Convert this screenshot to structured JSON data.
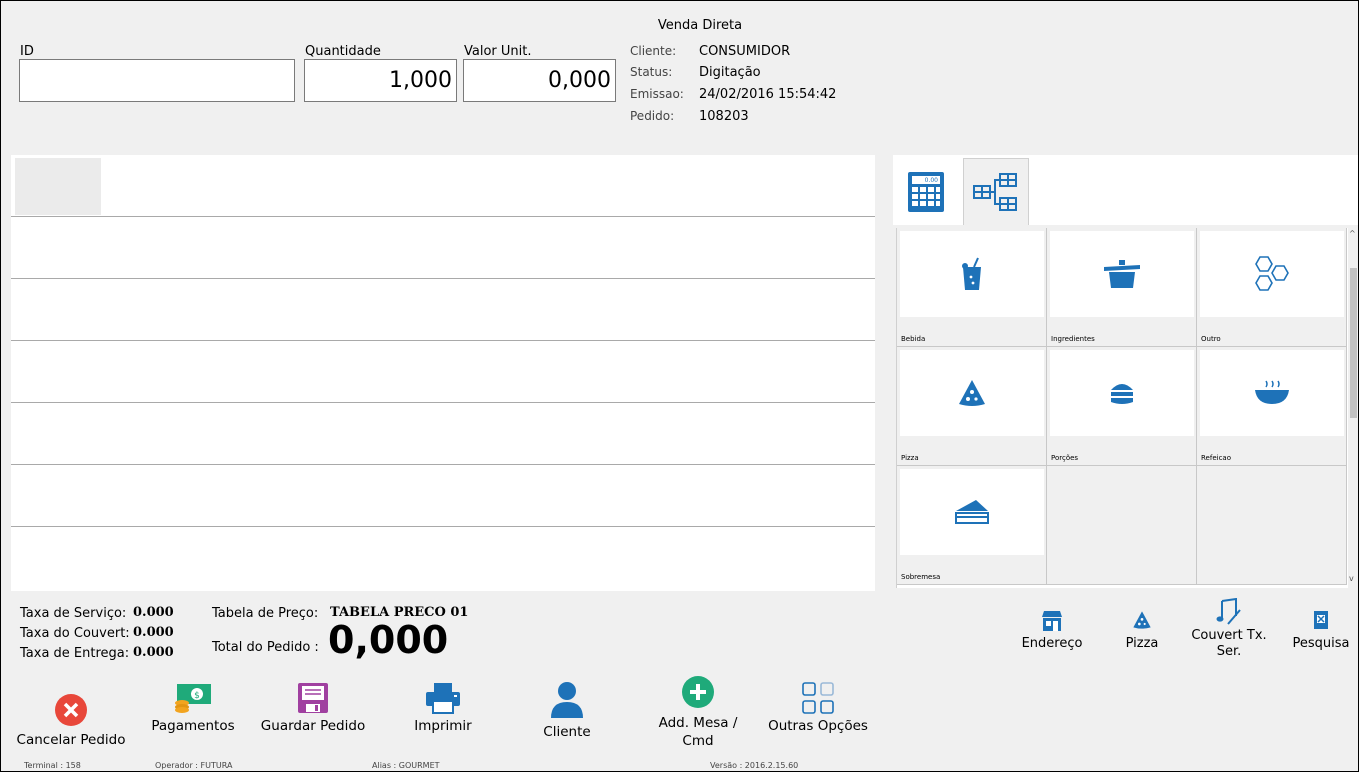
{
  "window": {
    "title": "Venda Direta"
  },
  "fields": {
    "id_label": "ID",
    "id_value": "",
    "quantidade_label": "Quantidade",
    "quantidade_value": "1,000",
    "valor_label": "Valor Unit.",
    "valor_value": "0,000"
  },
  "info": {
    "cliente_k": "Cliente:",
    "cliente_v": "CONSUMIDOR",
    "status_k": "Status:",
    "status_v": "Digitação",
    "emissao_k": "Emissao:",
    "emissao_v": "24/02/2016 15:54:42",
    "pedido_k": "Pedido:",
    "pedido_v": "108203"
  },
  "categories": [
    {
      "name": "Bebida",
      "icon": "drink-icon"
    },
    {
      "name": "Ingredientes",
      "icon": "pot-icon"
    },
    {
      "name": "Outro",
      "icon": "hexagons-icon"
    },
    {
      "name": "Pizza",
      "icon": "pizza-icon"
    },
    {
      "name": "Porções",
      "icon": "burger-icon"
    },
    {
      "name": "Refeicao",
      "icon": "soup-icon"
    },
    {
      "name": "Sobremesa",
      "icon": "cake-icon"
    }
  ],
  "totals": {
    "servico_k": "Taxa de Serviço:",
    "servico_v": "0.000",
    "couvert_k": "Taxa do Couvert:",
    "couvert_v": "0.000",
    "entrega_k": "Taxa de Entrega:",
    "entrega_v": "0.000",
    "tabela_k": "Tabela de Preço:",
    "tabela_v": "TABELA PRECO 01",
    "total_k": "Total do Pedido :",
    "total_v": "0,000"
  },
  "right_buttons": {
    "endereco": "Endereço",
    "pizza": "Pizza",
    "couvert": "Couvert Tx. Ser.",
    "pesquisa": "Pesquisa"
  },
  "actions": {
    "cancelar": "Cancelar Pedido",
    "pagamentos": "Pagamentos",
    "guardar": "Guardar Pedido",
    "imprimir": "Imprimir",
    "cliente": "Cliente",
    "add_mesa": "Add. Mesa / Cmd",
    "outras": "Outras Opções"
  },
  "status_bar": {
    "terminal": "Terminal : 158",
    "operador": "Operador : FUTURA",
    "alias": "Alias : GOURMET",
    "versao": "Versão : 2016.2.15.60"
  },
  "colors": {
    "accent": "#1e72b8",
    "cancel": "#e8473a",
    "add": "#1faa7a",
    "save": "#a040a0"
  }
}
